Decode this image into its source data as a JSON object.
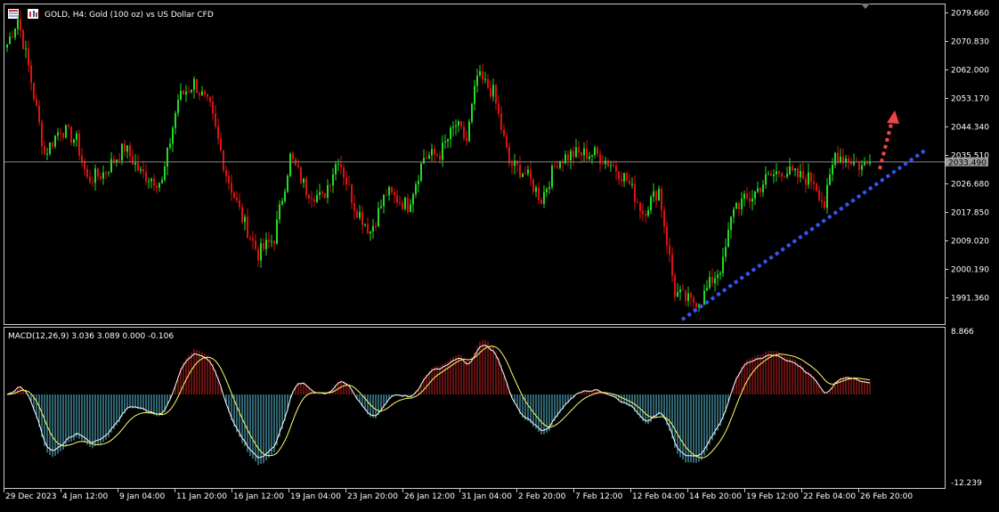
{
  "header": {
    "symbol_title": "GOLD, H4:  Gold (100 oz) vs US Dollar CFD"
  },
  "macd_header": {
    "label": "MACD(12,26,9) 3.036 3.089 0.000 -0.106"
  },
  "price_axis": {
    "labels": [
      "2079.660",
      "2070.830",
      "2062.000",
      "2053.170",
      "2044.340",
      "2035.510",
      "2026.680",
      "2017.850",
      "2009.020",
      "2000.190",
      "1991.360"
    ],
    "current_price": "2033.490"
  },
  "macd_axis": {
    "top_label": "8.866",
    "bottom_label": "-12.239"
  },
  "time_axis": {
    "labels": [
      "29 Dec 2023",
      "4 Jan 12:00",
      "9 Jan 04:00",
      "11 Jan 20:00",
      "16 Jan 12:00",
      "19 Jan 04:00",
      "23 Jan 20:00",
      "26 Jan 12:00",
      "31 Jan 04:00",
      "2 Feb 20:00",
      "7 Feb 12:00",
      "12 Feb 04:00",
      "14 Feb 20:00",
      "19 Feb 12:00",
      "22 Feb 04:00",
      "26 Feb 20:00"
    ]
  },
  "colors": {
    "background": "#000000",
    "bull": "#22dd22",
    "bear": "#dd1111",
    "grid_line": "#888888",
    "trendline": "#3355ee",
    "arrow": "#ee4444",
    "macd_pos": "#cc2222",
    "macd_neg": "#5ec8e0",
    "signal": "#ffff66",
    "macd_line": "#ffffff"
  },
  "chart_data": {
    "type": "candlestick",
    "title": "GOLD, H4:  Gold (100 oz) vs US Dollar CFD",
    "ylim": [
      1986.5,
      2084
    ],
    "current_price": 2033.49,
    "anchors": [
      [
        0,
        2070
      ],
      [
        4,
        2078
      ],
      [
        8,
        2063
      ],
      [
        14,
        2036
      ],
      [
        20,
        2044
      ],
      [
        26,
        2040
      ],
      [
        30,
        2028
      ],
      [
        36,
        2030
      ],
      [
        44,
        2038
      ],
      [
        50,
        2030
      ],
      [
        58,
        2027
      ],
      [
        64,
        2053
      ],
      [
        70,
        2058
      ],
      [
        76,
        2050
      ],
      [
        82,
        2030
      ],
      [
        88,
        2016
      ],
      [
        94,
        2005
      ],
      [
        100,
        2010
      ],
      [
        106,
        2035
      ],
      [
        112,
        2025
      ],
      [
        118,
        2022
      ],
      [
        124,
        2035
      ],
      [
        130,
        2020
      ],
      [
        136,
        2012
      ],
      [
        142,
        2024
      ],
      [
        150,
        2020
      ],
      [
        156,
        2035
      ],
      [
        162,
        2036
      ],
      [
        168,
        2045
      ],
      [
        172,
        2040
      ],
      [
        176,
        2060
      ],
      [
        182,
        2055
      ],
      [
        188,
        2033
      ],
      [
        194,
        2030
      ],
      [
        200,
        2022
      ],
      [
        206,
        2034
      ],
      [
        212,
        2036
      ],
      [
        220,
        2036
      ],
      [
        226,
        2033
      ],
      [
        232,
        2028
      ],
      [
        238,
        2018
      ],
      [
        244,
        2025
      ],
      [
        250,
        1993
      ],
      [
        256,
        1990
      ],
      [
        260,
        1991
      ],
      [
        264,
        1997
      ],
      [
        268,
        2002
      ],
      [
        272,
        2020
      ],
      [
        278,
        2022
      ],
      [
        284,
        2028
      ],
      [
        290,
        2031
      ],
      [
        296,
        2029
      ],
      [
        302,
        2028
      ],
      [
        306,
        2020
      ],
      [
        310,
        2036
      ],
      [
        316,
        2034
      ],
      [
        320,
        2032
      ],
      [
        323,
        2033.49
      ]
    ],
    "macd": {
      "ylim": [
        -12.239,
        8.866
      ],
      "values": [
        3.036,
        3.089,
        0.0,
        -0.106
      ]
    }
  }
}
